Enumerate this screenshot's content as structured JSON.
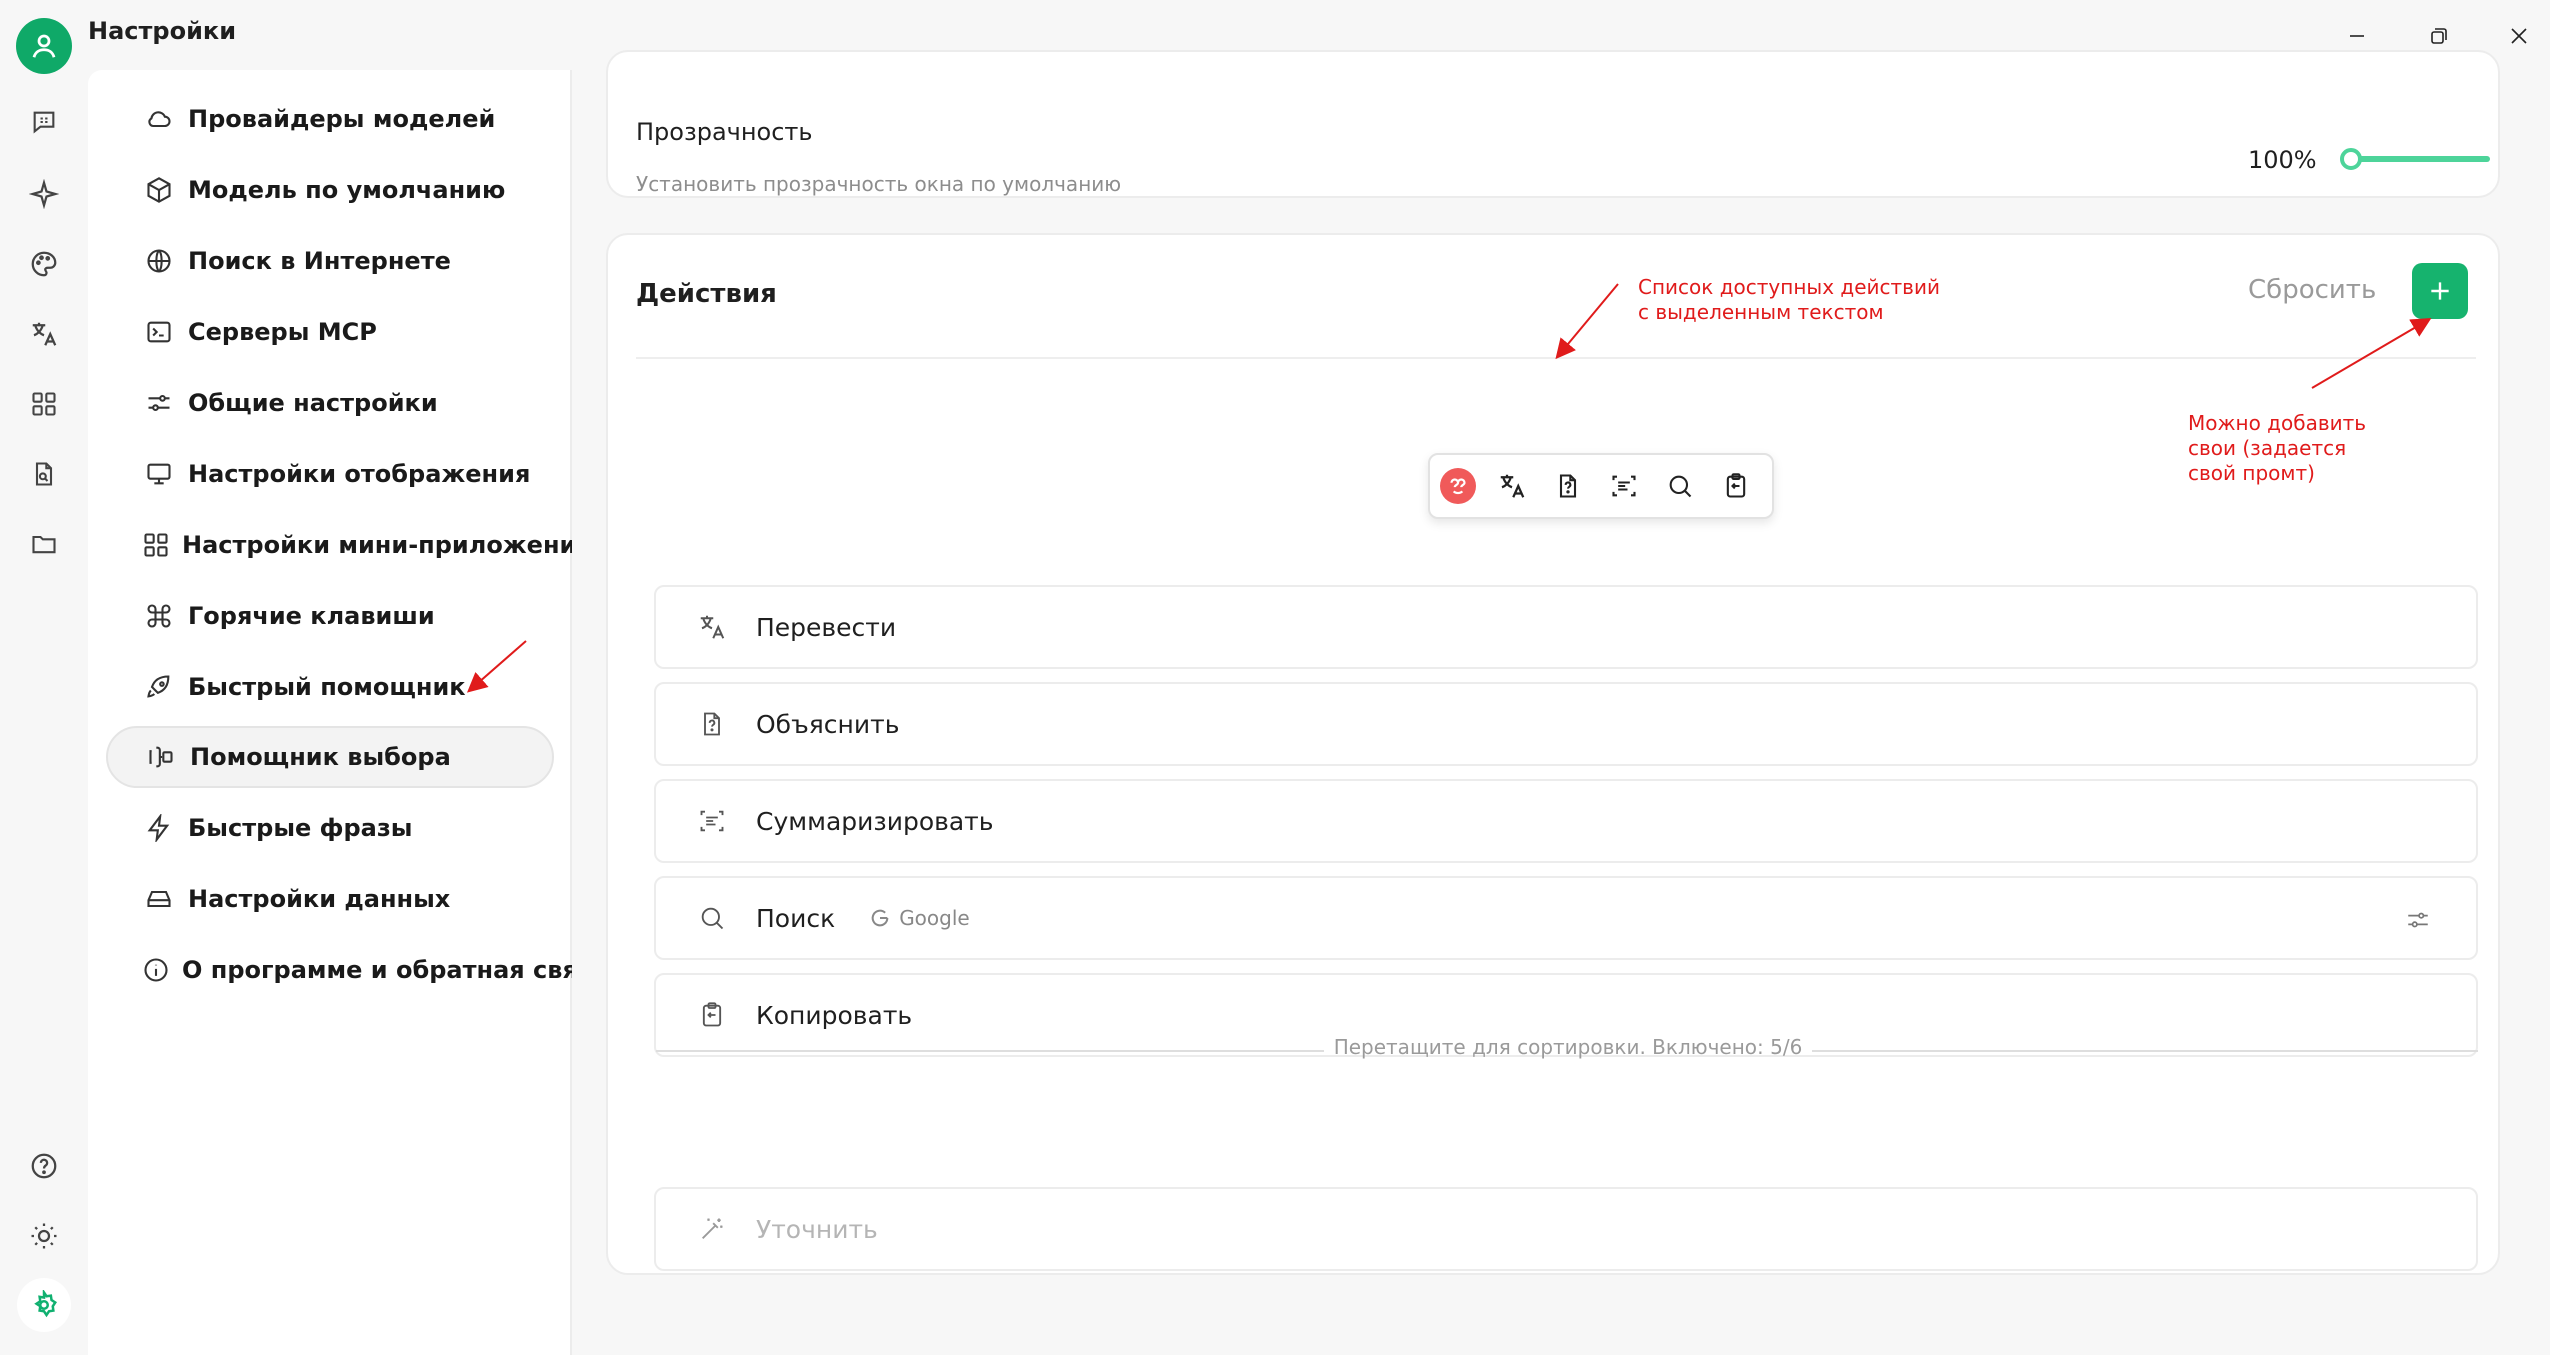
{
  "window": {
    "title": "Настройки"
  },
  "rail": {
    "items": [
      "chat",
      "assistants",
      "paint",
      "translate",
      "apps",
      "files",
      "folder"
    ],
    "bottom": [
      "help",
      "theme",
      "settings"
    ]
  },
  "nav": {
    "items": [
      {
        "label": "Провайдеры моделей",
        "icon": "cloud-icon"
      },
      {
        "label": "Модель по умолчанию",
        "icon": "cube-icon"
      },
      {
        "label": "Поиск в Интернете",
        "icon": "globe-icon"
      },
      {
        "label": "Серверы MCP",
        "icon": "terminal-icon"
      },
      {
        "label": "Общие настройки",
        "icon": "sliders-icon"
      },
      {
        "label": "Настройки отображения",
        "icon": "monitor-icon"
      },
      {
        "label": "Настройки мини-приложений",
        "icon": "grid-icon"
      },
      {
        "label": "Горячие клавиши",
        "icon": "command-icon"
      },
      {
        "label": "Быстрый помощник",
        "icon": "rocket-icon"
      },
      {
        "label": "Помощник выбора",
        "icon": "text-select-icon"
      },
      {
        "label": "Быстрые фразы",
        "icon": "zap-icon"
      },
      {
        "label": "Настройки данных",
        "icon": "drive-icon"
      },
      {
        "label": "О программе и обратная связь",
        "icon": "info-icon"
      }
    ],
    "active_index": 9
  },
  "transparency": {
    "title": "Прозрачность",
    "description": "Установить прозрачность окна по умолчанию",
    "value_label": "100%",
    "value": 1.0
  },
  "actions": {
    "title": "Действия",
    "reset_label": "Сбросить",
    "add_label": "+",
    "items": [
      {
        "label": "Перевести",
        "icon": "translate-icon",
        "enabled": true
      },
      {
        "label": "Объяснить",
        "icon": "file-question-icon",
        "enabled": true
      },
      {
        "label": "Суммаризировать",
        "icon": "scan-text-icon",
        "enabled": true
      },
      {
        "label": "Поиск",
        "icon": "search-icon",
        "enabled": true,
        "engine": "Google"
      },
      {
        "label": "Копировать",
        "icon": "clipboard-icon",
        "enabled": true
      }
    ],
    "sort_hint": "Перетащите для сортировки. Включено: 5/6",
    "disabled_items": [
      {
        "label": "Уточнить",
        "icon": "magic-wand-icon",
        "enabled": false
      }
    ]
  },
  "annotations": {
    "toolbar_note_line1": "Список доступных действий",
    "toolbar_note_line2": "с выделенным текстом",
    "add_note_line1": "Можно добавить",
    "add_note_line2": "свои (задается",
    "add_note_line3": "свой промт)",
    "color": "#e01b1b"
  },
  "colors": {
    "accent": "#16b36e",
    "slider": "#4dd49a"
  }
}
